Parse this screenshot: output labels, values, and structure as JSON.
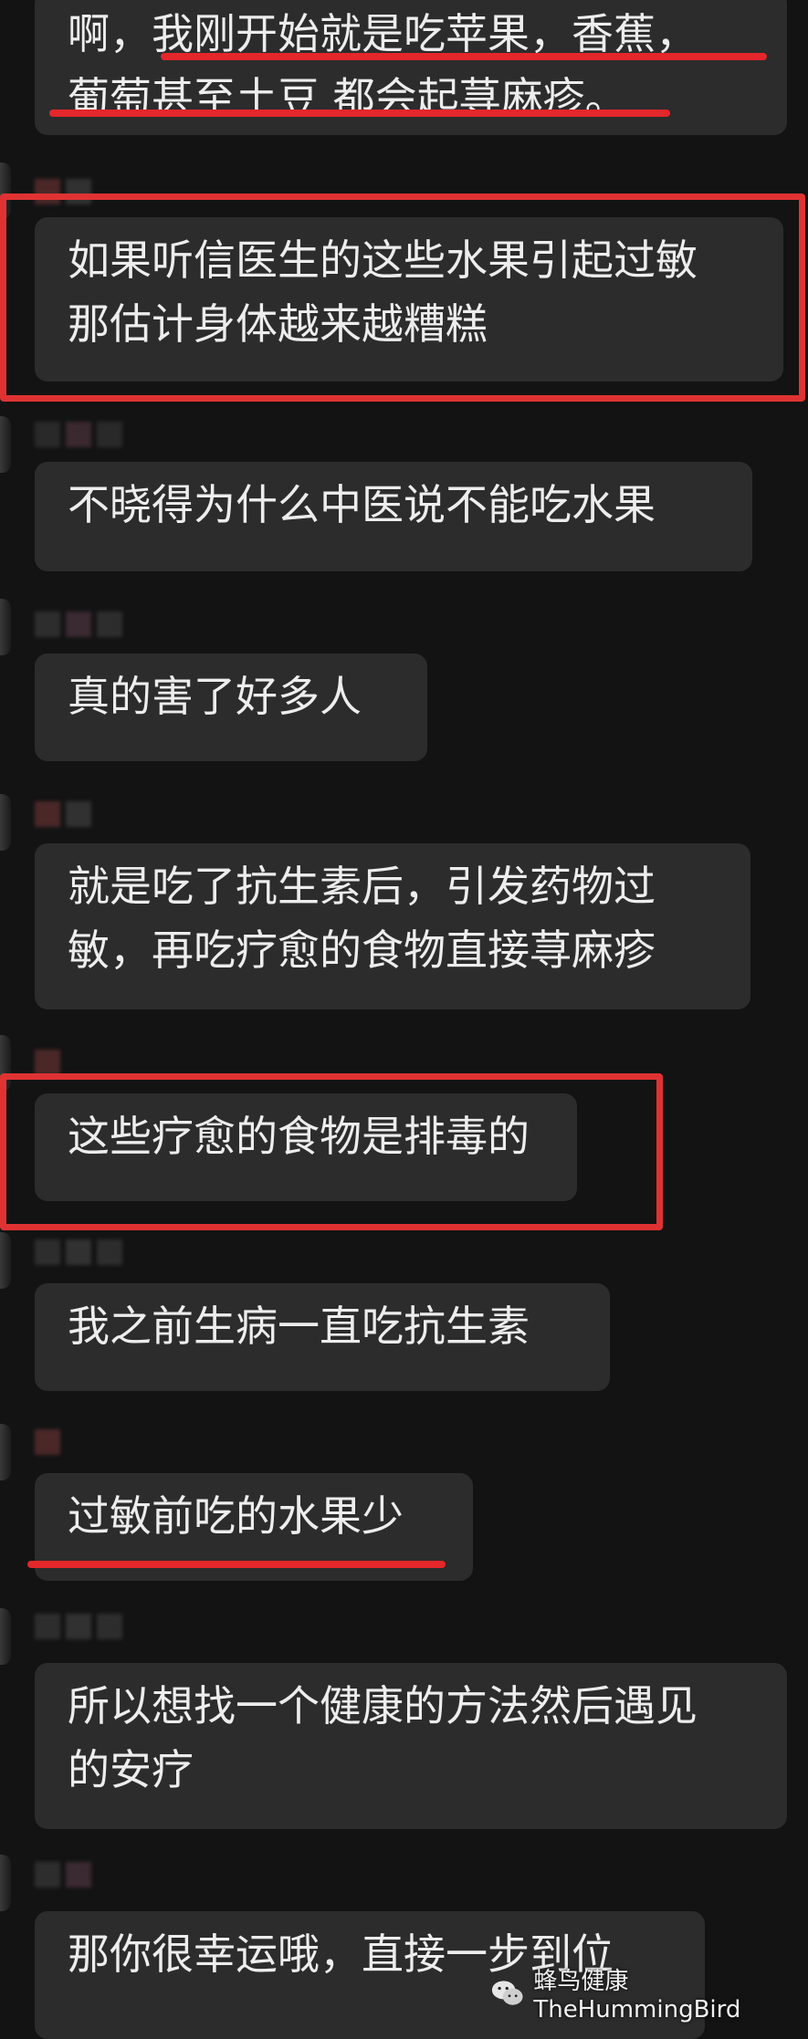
{
  "messages": [
    {
      "text": "啊，我刚开始就是吃苹果，香蕉，\n葡萄甚至土豆 都会起荨麻疹。"
    },
    {
      "text": "如果听信医生的这些水果引起过敏\n那估计身体越来越糟糕"
    },
    {
      "text": "不晓得为什么中医说不能吃水果"
    },
    {
      "text": "真的害了好多人"
    },
    {
      "text": "就是吃了抗生素后，引发药物过\n敏，再吃疗愈的食物直接荨麻疹"
    },
    {
      "text": "这些疗愈的食物是排毒的"
    },
    {
      "text": "我之前生病一直吃抗生素"
    },
    {
      "text": "过敏前吃的水果少"
    },
    {
      "text": "所以想找一个健康的方法然后遇见\n的安疗"
    },
    {
      "text": "那你很幸运哦，直接一步到位"
    }
  ],
  "watermark": {
    "text": "蜂鸟健康TheHummingBird",
    "icon": "wechat-icon"
  },
  "colors": {
    "bubble": "#2c2c2c",
    "background": "#131313",
    "highlight": "#e03232"
  }
}
